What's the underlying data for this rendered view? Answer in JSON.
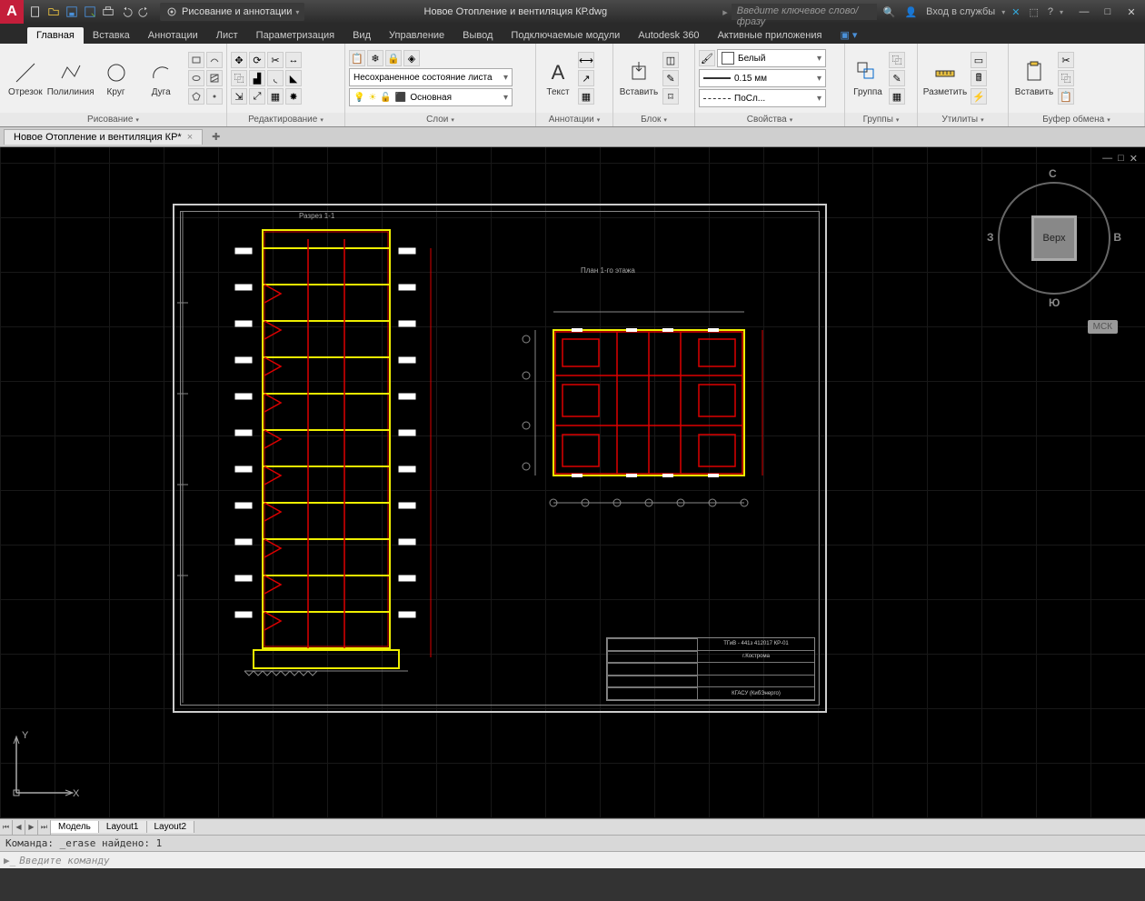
{
  "title_bar": {
    "workspace_label": "Рисование и аннотации",
    "document_title": "Новое Отопление и вентиляция КР.dwg",
    "search_placeholder": "Введите ключевое слово/фразу",
    "signin_label": "Вход в службы"
  },
  "ribbon_tabs": [
    "Главная",
    "Вставка",
    "Аннотации",
    "Лист",
    "Параметризация",
    "Вид",
    "Управление",
    "Вывод",
    "Подключаемые модули",
    "Autodesk 360",
    "Активные приложения"
  ],
  "active_tab": "Главная",
  "panels": {
    "draw": {
      "title": "Рисование",
      "buttons": {
        "line": "Отрезок",
        "polyline": "Полилиния",
        "circle": "Круг",
        "arc": "Дуга"
      }
    },
    "modify": {
      "title": "Редактирование"
    },
    "layers": {
      "title": "Слои",
      "state": "Несохраненное состояние листа",
      "current": "Основная"
    },
    "annotation": {
      "title": "Аннотации",
      "text": "Текст"
    },
    "block": {
      "title": "Блок",
      "insert": "Вставить"
    },
    "properties": {
      "title": "Свойства",
      "color": "Белый",
      "lineweight": "0.15 мм",
      "linetype": "ПоСл..."
    },
    "groups": {
      "title": "Группы",
      "group": "Группа"
    },
    "utilities": {
      "title": "Утилиты",
      "measure": "Разметить"
    },
    "clipboard": {
      "title": "Буфер обмена",
      "paste": "Вставить"
    }
  },
  "file_tab": "Новое Отопление и вентиляция КР*",
  "viewcube": {
    "face": "Верх",
    "n": "С",
    "s": "Ю",
    "e": "В",
    "w": "З",
    "coord": "МСК"
  },
  "drawing": {
    "section_label": "Разрез 1-1",
    "plan_label": "План 1-го этажа",
    "tb_project": "ТГиВ - 441з 412017 КР-01",
    "tb_city": "г.Кострома",
    "tb_org": "КГАСУ (КибЭнерго)"
  },
  "model_tabs": [
    "Модель",
    "Layout1",
    "Layout2"
  ],
  "active_model_tab": "Модель",
  "command": {
    "history": "Команда: _erase найдено: 1",
    "prompt": "Введите команду"
  },
  "window_controls": {
    "min": "—",
    "max": "□",
    "close": "✕"
  },
  "ucs": {
    "x": "X",
    "y": "Y"
  }
}
